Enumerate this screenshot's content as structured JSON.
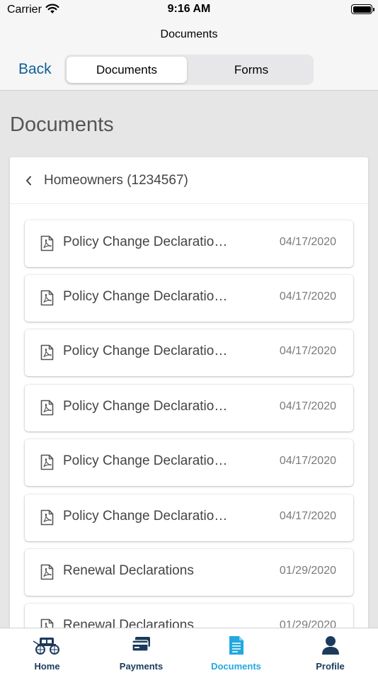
{
  "status_bar": {
    "carrier": "Carrier",
    "time": "9:16 AM"
  },
  "nav": {
    "title": "Documents",
    "back_label": "Back",
    "segments": [
      "Documents",
      "Forms"
    ],
    "selected_segment": "Documents"
  },
  "page": {
    "heading": "Documents"
  },
  "policy_card": {
    "title": "Homeowners (1234567)",
    "documents": [
      {
        "name": "Policy Change Declaratio…",
        "date": "04/17/2020"
      },
      {
        "name": "Policy Change Declaratio…",
        "date": "04/17/2020"
      },
      {
        "name": "Policy Change Declaratio…",
        "date": "04/17/2020"
      },
      {
        "name": "Policy Change Declaratio…",
        "date": "04/17/2020"
      },
      {
        "name": "Policy Change Declaratio…",
        "date": "04/17/2020"
      },
      {
        "name": "Policy Change Declaratio…",
        "date": "04/17/2020"
      },
      {
        "name": "Renewal Declarations",
        "date": "01/29/2020"
      },
      {
        "name": "Renewal Declarations",
        "date": "01/29/2020"
      }
    ]
  },
  "tab_bar": {
    "tabs": [
      {
        "label": "Home",
        "icon": "stagecoach-icon"
      },
      {
        "label": "Payments",
        "icon": "credit-card-icon"
      },
      {
        "label": "Documents",
        "icon": "document-icon"
      },
      {
        "label": "Profile",
        "icon": "person-icon"
      }
    ],
    "active": "Documents"
  },
  "colors": {
    "accent": "#0f5f95",
    "active_tab": "#22a9df",
    "tab_text": "#1b3a5c"
  }
}
